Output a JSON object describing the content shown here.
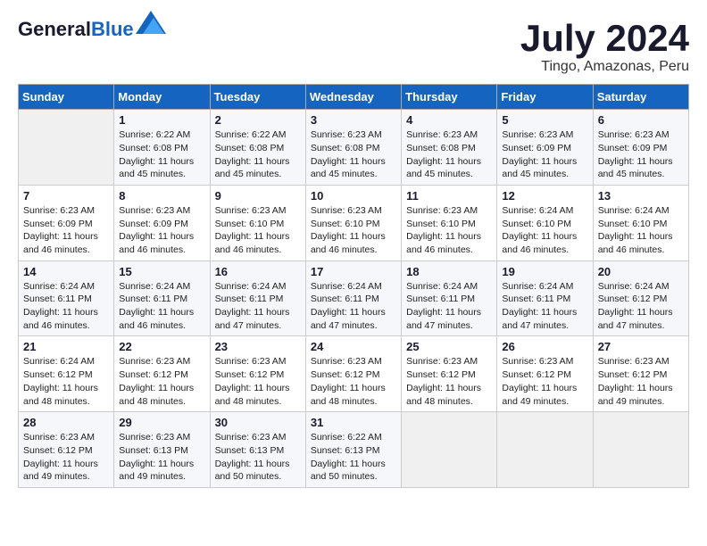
{
  "header": {
    "logo_general": "General",
    "logo_blue": "Blue",
    "month_year": "July 2024",
    "location": "Tingo, Amazonas, Peru"
  },
  "calendar": {
    "days_of_week": [
      "Sunday",
      "Monday",
      "Tuesday",
      "Wednesday",
      "Thursday",
      "Friday",
      "Saturday"
    ],
    "weeks": [
      [
        {
          "day": "",
          "info": ""
        },
        {
          "day": "1",
          "info": "Sunrise: 6:22 AM\nSunset: 6:08 PM\nDaylight: 11 hours and 45 minutes."
        },
        {
          "day": "2",
          "info": "Sunrise: 6:22 AM\nSunset: 6:08 PM\nDaylight: 11 hours and 45 minutes."
        },
        {
          "day": "3",
          "info": "Sunrise: 6:23 AM\nSunset: 6:08 PM\nDaylight: 11 hours and 45 minutes."
        },
        {
          "day": "4",
          "info": "Sunrise: 6:23 AM\nSunset: 6:08 PM\nDaylight: 11 hours and 45 minutes."
        },
        {
          "day": "5",
          "info": "Sunrise: 6:23 AM\nSunset: 6:09 PM\nDaylight: 11 hours and 45 minutes."
        },
        {
          "day": "6",
          "info": "Sunrise: 6:23 AM\nSunset: 6:09 PM\nDaylight: 11 hours and 45 minutes."
        }
      ],
      [
        {
          "day": "7",
          "info": "Sunrise: 6:23 AM\nSunset: 6:09 PM\nDaylight: 11 hours and 46 minutes."
        },
        {
          "day": "8",
          "info": "Sunrise: 6:23 AM\nSunset: 6:09 PM\nDaylight: 11 hours and 46 minutes."
        },
        {
          "day": "9",
          "info": "Sunrise: 6:23 AM\nSunset: 6:10 PM\nDaylight: 11 hours and 46 minutes."
        },
        {
          "day": "10",
          "info": "Sunrise: 6:23 AM\nSunset: 6:10 PM\nDaylight: 11 hours and 46 minutes."
        },
        {
          "day": "11",
          "info": "Sunrise: 6:23 AM\nSunset: 6:10 PM\nDaylight: 11 hours and 46 minutes."
        },
        {
          "day": "12",
          "info": "Sunrise: 6:24 AM\nSunset: 6:10 PM\nDaylight: 11 hours and 46 minutes."
        },
        {
          "day": "13",
          "info": "Sunrise: 6:24 AM\nSunset: 6:10 PM\nDaylight: 11 hours and 46 minutes."
        }
      ],
      [
        {
          "day": "14",
          "info": "Sunrise: 6:24 AM\nSunset: 6:11 PM\nDaylight: 11 hours and 46 minutes."
        },
        {
          "day": "15",
          "info": "Sunrise: 6:24 AM\nSunset: 6:11 PM\nDaylight: 11 hours and 46 minutes."
        },
        {
          "day": "16",
          "info": "Sunrise: 6:24 AM\nSunset: 6:11 PM\nDaylight: 11 hours and 47 minutes."
        },
        {
          "day": "17",
          "info": "Sunrise: 6:24 AM\nSunset: 6:11 PM\nDaylight: 11 hours and 47 minutes."
        },
        {
          "day": "18",
          "info": "Sunrise: 6:24 AM\nSunset: 6:11 PM\nDaylight: 11 hours and 47 minutes."
        },
        {
          "day": "19",
          "info": "Sunrise: 6:24 AM\nSunset: 6:11 PM\nDaylight: 11 hours and 47 minutes."
        },
        {
          "day": "20",
          "info": "Sunrise: 6:24 AM\nSunset: 6:12 PM\nDaylight: 11 hours and 47 minutes."
        }
      ],
      [
        {
          "day": "21",
          "info": "Sunrise: 6:24 AM\nSunset: 6:12 PM\nDaylight: 11 hours and 48 minutes."
        },
        {
          "day": "22",
          "info": "Sunrise: 6:23 AM\nSunset: 6:12 PM\nDaylight: 11 hours and 48 minutes."
        },
        {
          "day": "23",
          "info": "Sunrise: 6:23 AM\nSunset: 6:12 PM\nDaylight: 11 hours and 48 minutes."
        },
        {
          "day": "24",
          "info": "Sunrise: 6:23 AM\nSunset: 6:12 PM\nDaylight: 11 hours and 48 minutes."
        },
        {
          "day": "25",
          "info": "Sunrise: 6:23 AM\nSunset: 6:12 PM\nDaylight: 11 hours and 48 minutes."
        },
        {
          "day": "26",
          "info": "Sunrise: 6:23 AM\nSunset: 6:12 PM\nDaylight: 11 hours and 49 minutes."
        },
        {
          "day": "27",
          "info": "Sunrise: 6:23 AM\nSunset: 6:12 PM\nDaylight: 11 hours and 49 minutes."
        }
      ],
      [
        {
          "day": "28",
          "info": "Sunrise: 6:23 AM\nSunset: 6:12 PM\nDaylight: 11 hours and 49 minutes."
        },
        {
          "day": "29",
          "info": "Sunrise: 6:23 AM\nSunset: 6:13 PM\nDaylight: 11 hours and 49 minutes."
        },
        {
          "day": "30",
          "info": "Sunrise: 6:23 AM\nSunset: 6:13 PM\nDaylight: 11 hours and 50 minutes."
        },
        {
          "day": "31",
          "info": "Sunrise: 6:22 AM\nSunset: 6:13 PM\nDaylight: 11 hours and 50 minutes."
        },
        {
          "day": "",
          "info": ""
        },
        {
          "day": "",
          "info": ""
        },
        {
          "day": "",
          "info": ""
        }
      ]
    ]
  }
}
